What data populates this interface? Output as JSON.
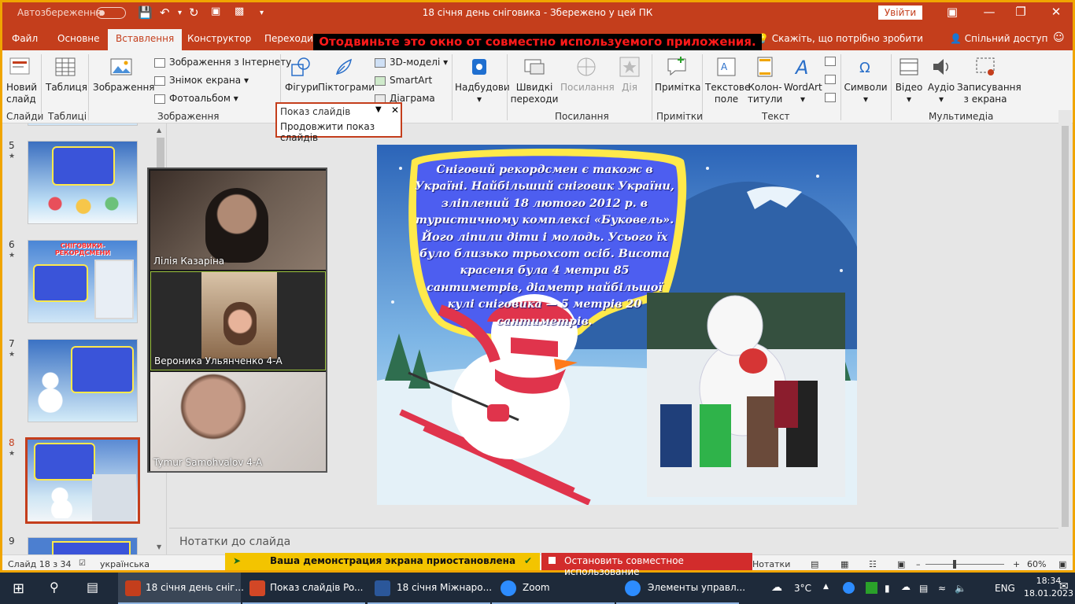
{
  "window": {
    "autosave_label": "Автозбереження",
    "toggle_state": "off",
    "title": "18 січня день сніговика  -  Збережено у цей ПК",
    "signin_label": "Увійти"
  },
  "tabs": [
    "Файл",
    "Основне",
    "Вставлення",
    "Конструктор",
    "Переходи"
  ],
  "active_tab": "Вставлення",
  "warning_banner": "Отодвиньте это окно от совместно используемого приложения.",
  "tell_me": "Скажіть, що потрібно зробити",
  "shared_access": "Спільний доступ",
  "ribbon": {
    "new_slide": "Новий слайд",
    "slides_group": "Слайди",
    "table": "Таблиця",
    "tables_group": "Таблиці",
    "images": "Зображення",
    "online_images": "Зображення з Інтернету",
    "screenshot": "Знімок екрана",
    "photo_album": "Фотоальбом",
    "images_group": "Зображення",
    "shapes": "Фігури",
    "icons": "Піктограми",
    "models_3d": "3D-моделі",
    "smartart": "SmartArt",
    "chart": "Діаграма",
    "addins": "Надбудови",
    "quick_links": "Швидкі переходи",
    "link": "Посилання",
    "action": "Дія",
    "links_group": "Посилання",
    "comment": "Примітка",
    "comments_group": "Примітки",
    "textbox": "Текстове поле",
    "header_footer": "Колон-титули",
    "wordart": "WordArt",
    "text_group": "Текст",
    "symbols": "Символи",
    "video": "Відео",
    "audio": "Аудіо",
    "screen_recording": "Записування з екрана",
    "media_group": "Мультимедіа"
  },
  "popup": {
    "title": "Показ слайдів",
    "item": "Продовжити показ слайдів"
  },
  "slide_thumbs": [
    {
      "num": "5",
      "thumb_title": ""
    },
    {
      "num": "6",
      "thumb_title": "СНІГОВИКИ-РЕКОРДСМЕНИ"
    },
    {
      "num": "7",
      "thumb_title": ""
    },
    {
      "num": "8",
      "thumb_title": ""
    },
    {
      "num": "9",
      "thumb_title": ""
    }
  ],
  "selected_thumb": "8",
  "participants": [
    {
      "name": "Лілія Казаріна"
    },
    {
      "name": "Вероника Ульянченко 4-А"
    },
    {
      "name": "Tymur Samohvalov 4-A"
    }
  ],
  "slide_text": "Сніговий  рекордсмен  є також  в Україні. Найбільший сніговик  України, зліплений 18 лютого  2012 р. в туристичному комплексі  «Буковель». Його  ліпили діти і молодь. Усього їх було близько трьохсот осіб. Висота красеня  була 4 метри 85 сантиметрів, діаметр найбільшої  кулі сніговика — 5 метрів 20 сантиметрів.",
  "notes_placeholder": "Нотатки до слайда",
  "statusbar": {
    "slide_of": "Слайд 18 з 34",
    "language": "українська",
    "notes": "Нотатки",
    "zoom": "60%"
  },
  "share_bar": {
    "paused": "Ваша демонстрация экрана приостановлена",
    "stop": "Остановить совместное использование"
  },
  "taskbar": {
    "items": [
      "18 січня день сніг...",
      "Показ слайдів Po...",
      "18 січня  Міжнаро...",
      "Zoom",
      "Элементы управл..."
    ],
    "weather": "3°C",
    "lang": "ENG",
    "time": "18:34",
    "date": "18.01.2023"
  },
  "colors": {
    "accent": "#c43e1c",
    "share_yellow": "#f3c400",
    "stop_red": "#d22c2c"
  }
}
